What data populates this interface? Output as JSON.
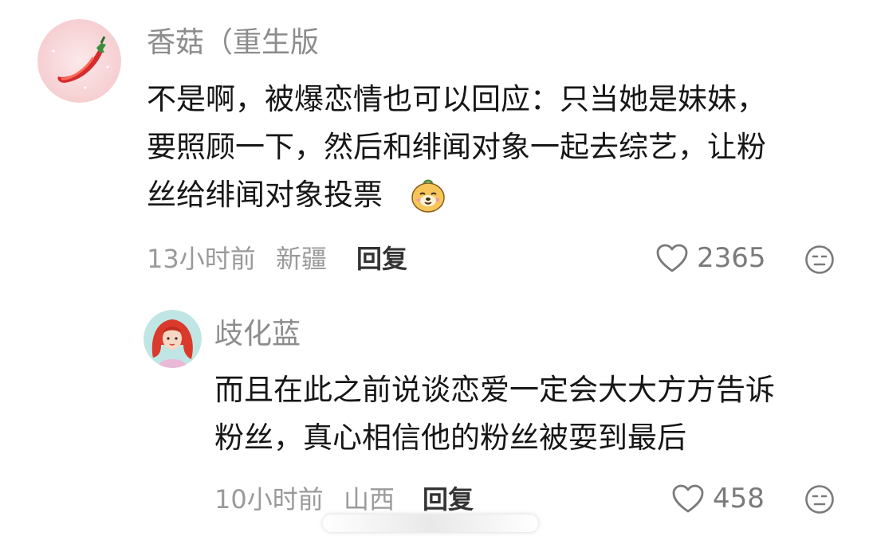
{
  "comments": [
    {
      "avatar_icon": "chili-pepper-icon",
      "username": "香菇（重生版",
      "lines": [
        "不是啊，被爆恋情也可以回应：只当她是妹妹，",
        "要照顾一下，然后和绯闻对象一起去综艺，让粉",
        "丝给绯闻对象投票"
      ],
      "inline_emoji": "smiling-dog-emoji",
      "time": "13小时前",
      "location": "新疆",
      "reply_label": "回复",
      "likes": "2365"
    },
    {
      "avatar_icon": "red-hair-girl-avatar",
      "username": "歧化蓝",
      "lines": [
        "而且在此之前说谈恋爱一定会大大方方告诉",
        "粉丝，真心相信他的粉丝被耍到最后"
      ],
      "time": "10小时前",
      "location": "山西",
      "reply_label": "回复",
      "likes": "458"
    }
  ],
  "icons": {
    "like": "heart-outline-icon",
    "more": "face-emoji-icon"
  }
}
